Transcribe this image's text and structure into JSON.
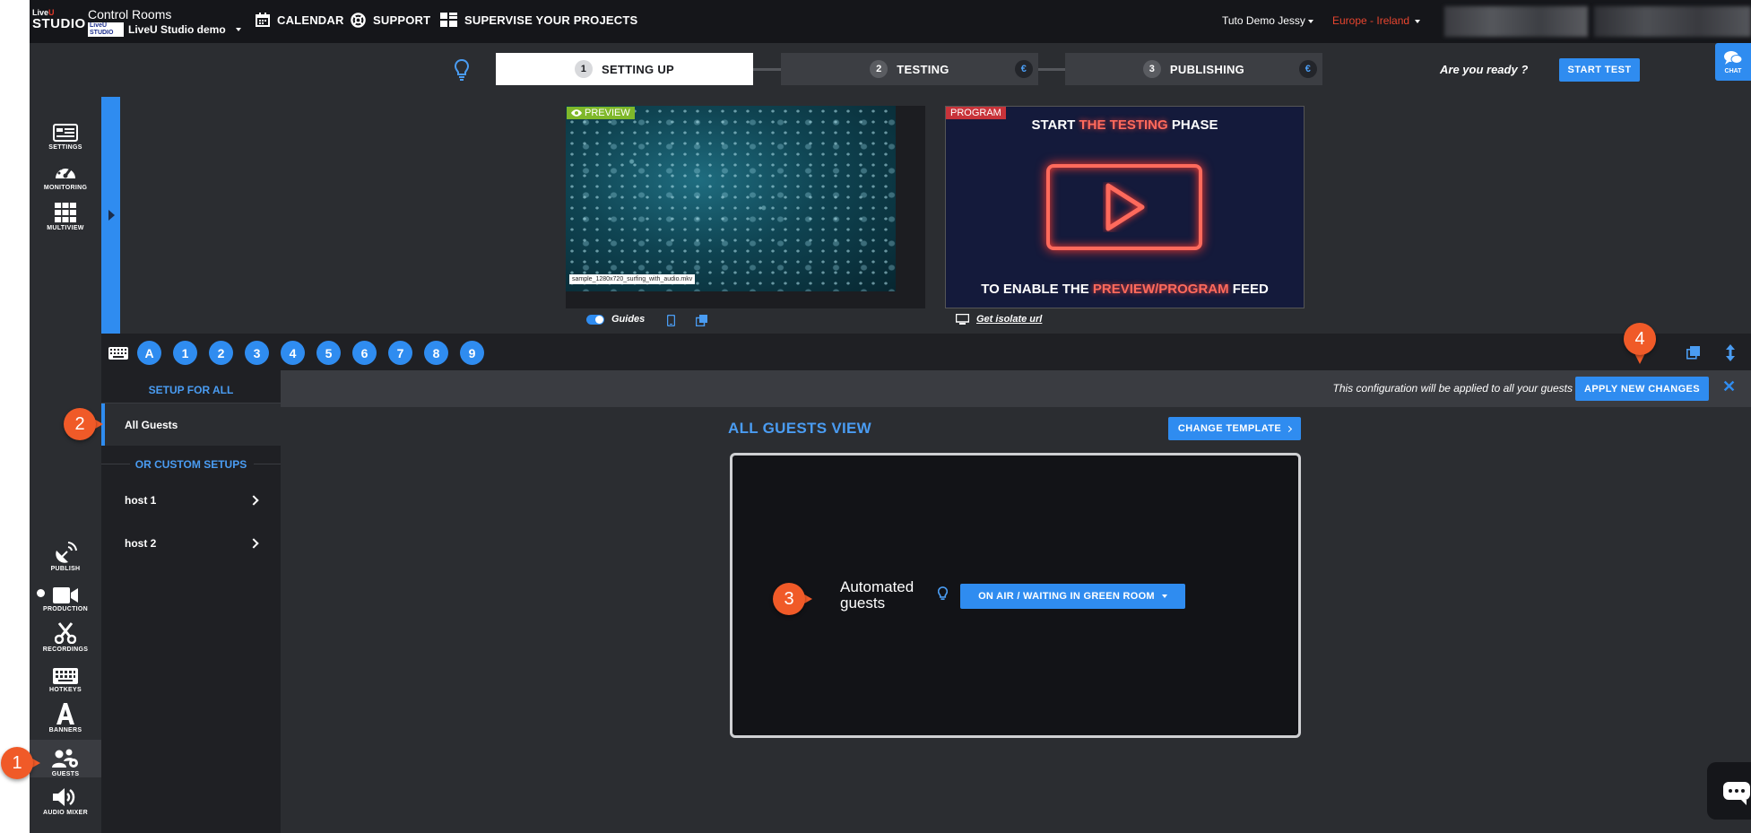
{
  "logo": {
    "line1_a": "Live",
    "line1_b": "U",
    "line2": "STUDIO"
  },
  "header": {
    "title": "Control Rooms",
    "project_badge": "LiveU STUDIO",
    "project_name": "LiveU Studio demo",
    "nav": {
      "calendar": "CALENDAR",
      "support": "SUPPORT",
      "supervise": "SUPERVISE YOUR PROJECTS"
    },
    "user": "Tuto Demo Jessy",
    "region": "Europe - Ireland"
  },
  "steps": [
    {
      "num": "1",
      "label": "SETTING UP"
    },
    {
      "num": "2",
      "label": "TESTING",
      "badge": "€"
    },
    {
      "num": "3",
      "label": "PUBLISHING",
      "badge": "€"
    }
  ],
  "ready_text": "Are you ready ?",
  "start_test": "START TEST",
  "chat_label": "CHAT",
  "sidebar_top": [
    {
      "label": "SETTINGS",
      "icon": "settings-icon"
    },
    {
      "label": "MONITORING",
      "icon": "gauge-icon"
    },
    {
      "label": "MULTIVIEW",
      "icon": "grid-icon"
    }
  ],
  "sidebar_bottom": [
    {
      "label": "PUBLISH",
      "icon": "satellite-icon"
    },
    {
      "label": "PRODUCTION",
      "icon": "video-camera-icon"
    },
    {
      "label": "RECORDINGS",
      "icon": "scissors-icon"
    },
    {
      "label": "HOTKEYS",
      "icon": "keyboard-icon"
    },
    {
      "label": "BANNERS",
      "icon": "letter-a-icon"
    },
    {
      "label": "GUESTS",
      "icon": "guests-icon"
    },
    {
      "label": "AUDIO MIXER",
      "icon": "speaker-icon"
    }
  ],
  "monitors": {
    "preview_tag": "PREVIEW",
    "filename": "sample_1280x720_surfing_with_audio.mkv",
    "program_tag": "PROGRAM",
    "program_line1_a": "START ",
    "program_line1_b": "THE TESTING",
    "program_line1_c": " PHASE",
    "program_line2_a": "TO ENABLE THE ",
    "program_line2_b": "PREVIEW/PROGRAM",
    "program_line2_c": " FEED",
    "guides": "Guides",
    "isolate": "Get isolate url"
  },
  "hotkeys": [
    "A",
    "1",
    "2",
    "3",
    "4",
    "5",
    "6",
    "7",
    "8",
    "9"
  ],
  "guests": {
    "setup_for_all": "SETUP FOR ALL",
    "all_guests": "All Guests",
    "custom_setups": "OR CUSTOM SETUPS",
    "hosts": [
      "host 1",
      "host 2"
    ],
    "config_notice": "This configuration will be applied to all your guests",
    "apply_button": "APPLY NEW CHANGES",
    "close": "✕",
    "view_title": "ALL GUESTS VIEW",
    "change_template": "CHANGE TEMPLATE",
    "automated_line1": "Automated",
    "automated_line2": "guests",
    "dropdown_value": "ON AIR / WAITING IN GREEN ROOM"
  },
  "callouts": [
    "1",
    "2",
    "3",
    "4"
  ],
  "colors": {
    "accent": "#2f8cf0",
    "callout": "#f05a28",
    "region": "#e8452f",
    "preview": "#7fb82a",
    "program": "#c8333a"
  }
}
